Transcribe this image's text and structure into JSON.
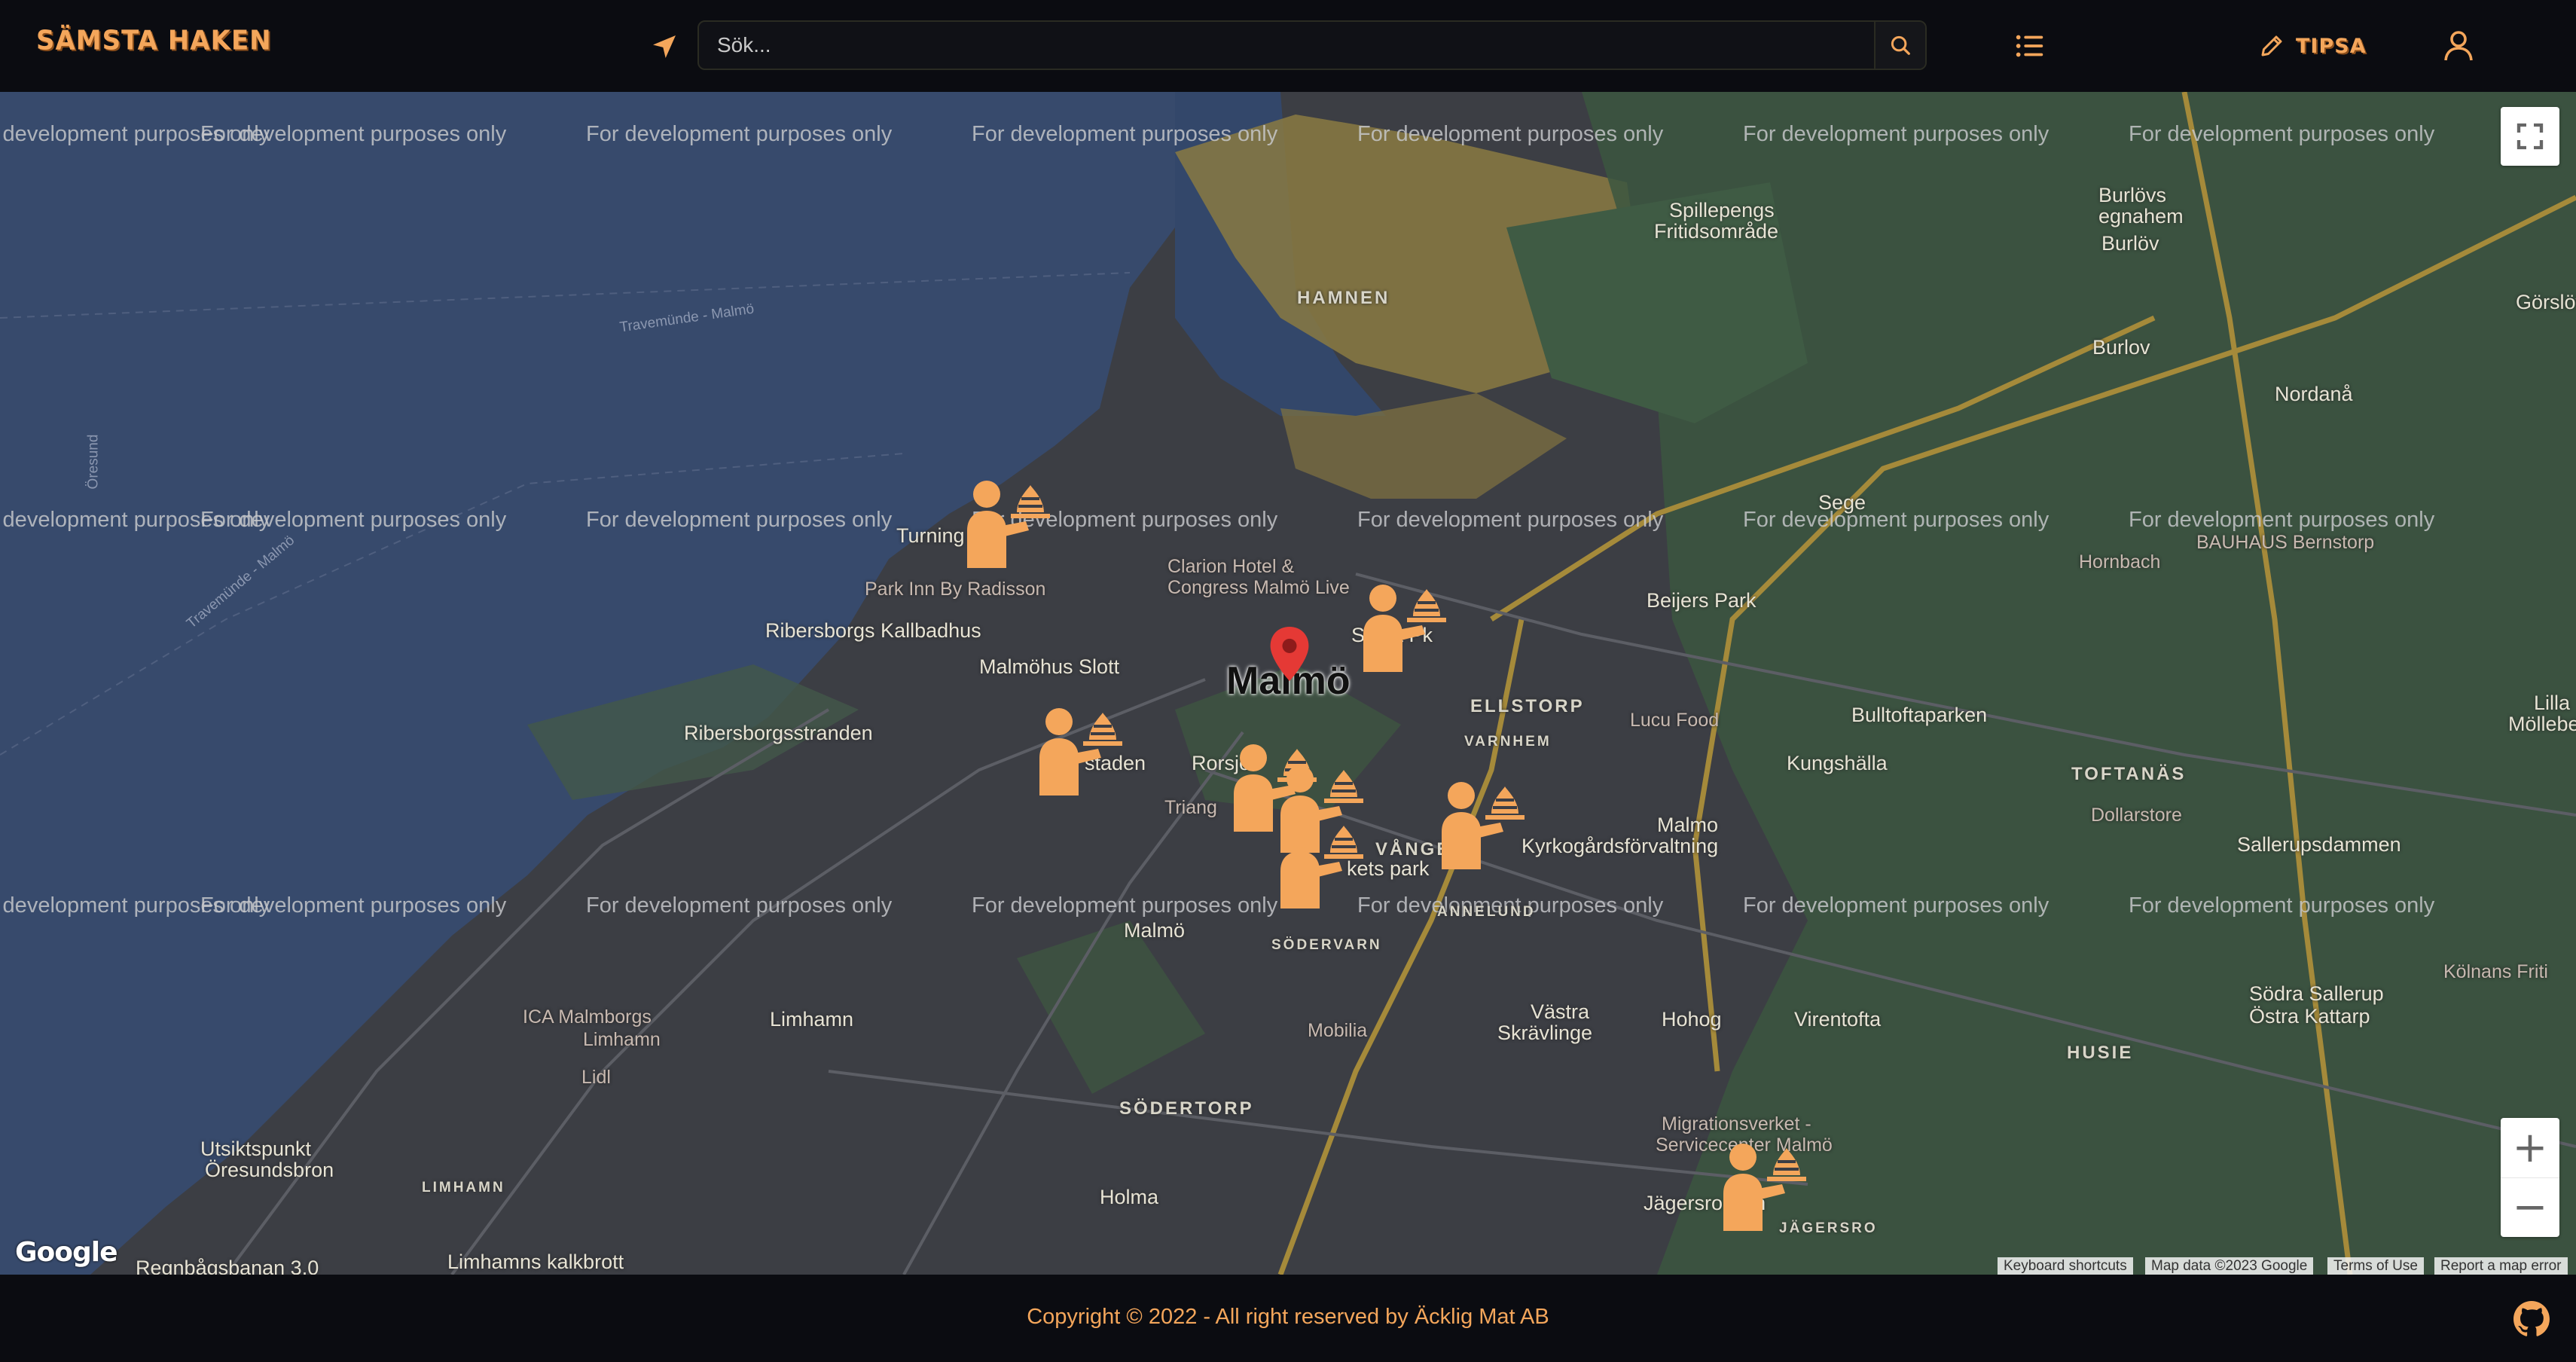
{
  "header": {
    "logo": "SÄMSTA HAKEN",
    "search_placeholder": "Sök...",
    "tipsa_label": "TIPSA",
    "icons": {
      "locate": "location-arrow-icon",
      "search": "search-icon",
      "list": "list-icon",
      "tipsa": "pencil-icon",
      "user": "user-icon"
    }
  },
  "map": {
    "watermark": "For development purposes only",
    "city_label": "Malmö",
    "area_labels": {
      "hamnen": "HAMNEN",
      "ellstorp": "ELLSTORP",
      "varnhem": "VARNHEM",
      "toftanas": "TOFTANÄS",
      "sodervarn": "SÖDERVARN",
      "annelund": "ANNELUND",
      "sodertorp": "SÖDERTORP",
      "husie": "HUSIE",
      "limhamn_caps": "LIMHAMN",
      "jagersro": "JÄGERSRO",
      "vangen": "VÅNGEN"
    },
    "place_labels": {
      "spillepeng": "Spillepengs",
      "fritidsomrade": "Fritidsområde",
      "burlovs": "Burlövs",
      "egnahem": "egnahem",
      "burlov1": "Burlöv",
      "burlov2": "Burlov",
      "gorslov": "Görslöv",
      "nordana": "Nordanå",
      "sege": "Sege",
      "hornbach": "Hornbach",
      "bauhaus": "BAUHAUS Bernstorp",
      "beijers": "Beijers Park",
      "turning": "Turning",
      "parkinn": "Park Inn By Radisson",
      "clarion1": "Clarion Hotel &",
      "clarion2": "Congress Malmö Live",
      "sanktpk": "Sankt Pk",
      "ribersborgs_kb": "Ribersborgs Kallbadhus",
      "malmohus": "Malmöhus Slott",
      "ribersborgsstranden": "Ribersborgsstranden",
      "lucu": "Lucu Food",
      "bulltofta": "Bulltoftaparken",
      "kungshalla": "Kungshälla",
      "lilla1": "Lilla",
      "lilla2": "Möllebergа",
      "dollarstore": "Dollarstore",
      "sallerupsdammen": "Sallerupsdammen",
      "stadens": "stаden",
      "rorsjo": "Rorsjö",
      "triang": "Triang",
      "kets": "kets park",
      "malmo2": "Malmö",
      "malmo3": "Malmo",
      "kyrkogard": "Kyrkogårdsförvaltning",
      "limhamn": "Limhamn",
      "ica1": "ICA Malmborgs",
      "ica2": "Limhamn",
      "lidl": "Lidl",
      "mobilia": "Mobilia",
      "vastra1": "Västra",
      "vastra2": "Skrävlinge",
      "hohog": "Hohog",
      "virentofta": "Virentofta",
      "sodra1": "Södra Sallerup",
      "sodra2": "Östra Kattarp",
      "kolnans": "Kölnans Friti",
      "migr1": "Migrationsverket -",
      "migr2": "Servicecenter Malmö",
      "jagersro_cen": "Jägersro Cen",
      "holma": "Holma",
      "utsikt1": "Utsiktspunkt",
      "utsikt2": "Öresundsbron",
      "limhamn_kb": "Limhamns kalkbrott",
      "regnbag": "Regnbågsbanan 3.0",
      "travemunde1": "Travemünde - Malmö",
      "travemunde2": "Travemünde - Malmö",
      "oresund": "Öresund"
    },
    "controls": {
      "fullscreen_icon": "fullscreen-icon",
      "zoom_in": "+",
      "zoom_out": "−"
    },
    "google_logo": "Google",
    "attribution": {
      "shortcuts": "Keyboard shortcuts",
      "map_data": "Map data ©2023 Google",
      "terms": "Terms of Use",
      "report": "Report a map error"
    },
    "restaurant_marker_icon": "waiter-serving-icon",
    "selected_pin_icon": "map-pin-icon"
  },
  "footer": {
    "copyright": "Copyright © 2022 - All right reserved by Äcklig Mat AB",
    "github_icon": "github-icon"
  },
  "colors": {
    "accent": "#f4a65b",
    "header_bg": "#0b0c11",
    "water": "#374a6c",
    "land": "#3c3e44",
    "park": "#3b5640",
    "industrial": "#8a7a42",
    "pin": "#e53935"
  }
}
